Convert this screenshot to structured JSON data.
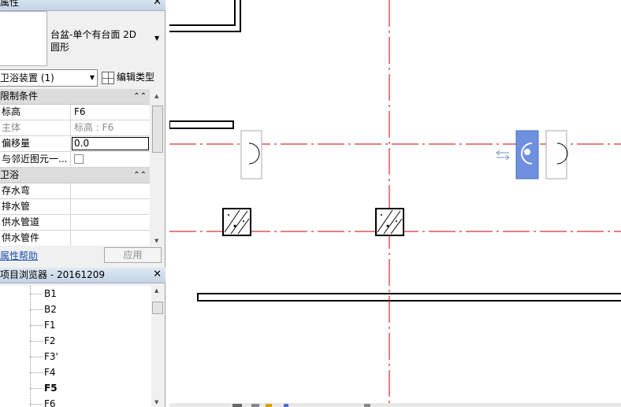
{
  "properties_panel": {
    "title": "属性",
    "type_name": "台盆-单个有台面 2D 圆形",
    "instance_filter": "卫浴装置 (1)",
    "edit_type_label": "编辑类型",
    "groups": [
      {
        "label": "限制条件",
        "rows": [
          {
            "name": "标高",
            "value": "F6"
          },
          {
            "name": "主体",
            "value": "标高 : F6"
          },
          {
            "name": "偏移量",
            "value": "0.0"
          },
          {
            "name": "与邻近图元一...",
            "value": ""
          }
        ]
      },
      {
        "label": "卫浴",
        "rows": [
          {
            "name": "存水弯",
            "value": ""
          },
          {
            "name": "排水管",
            "value": ""
          },
          {
            "name": "供水管道",
            "value": ""
          },
          {
            "name": "供水管件",
            "value": ""
          }
        ]
      }
    ],
    "help_link": "属性帮助",
    "apply_label": "应用"
  },
  "project_browser": {
    "title": "项目浏览器 - 20161209",
    "levels": [
      "B1",
      "B2",
      "F1",
      "F2",
      "F3'",
      "F4",
      "F5",
      "F6"
    ],
    "active_level": "F5"
  },
  "colors": {
    "grid_line": "#c80000",
    "selection_fill": "#6f8fdf",
    "panel_bg": "#f0f0f0"
  }
}
